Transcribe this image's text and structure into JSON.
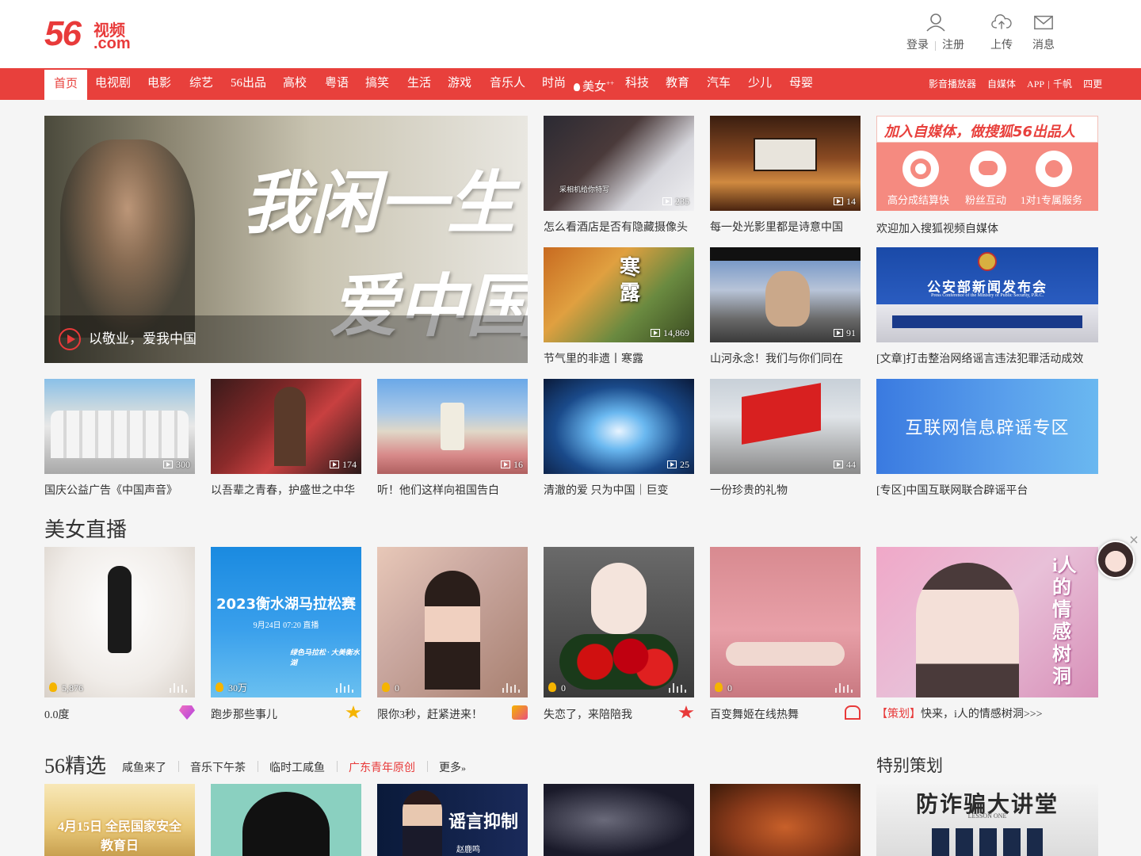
{
  "header": {
    "logo_num": "56",
    "logo_cn": "视频",
    "logo_com": ".com",
    "login": "登录",
    "register": "注册",
    "upload": "上传",
    "messages": "消息"
  },
  "nav": {
    "items": [
      "首页",
      "电视剧",
      "电影",
      "综艺",
      "56出品",
      "高校",
      "粤语",
      "搞笑",
      "生活",
      "游戏",
      "音乐人",
      "时尚",
      "美女",
      "科技",
      "教育",
      "汽车",
      "少儿",
      "母婴"
    ],
    "right": [
      "影音播放器",
      "自媒体",
      "APP",
      "千帆",
      "四更"
    ],
    "beauty_sup": "++"
  },
  "hero": {
    "title": "以敬业，爱我中国",
    "art_line1": "我闲一生",
    "art_line2": "爱中国"
  },
  "grid": [
    {
      "caption": "怎么看酒店是否有隐藏摄像头",
      "count": "235"
    },
    {
      "caption": "每一处光影里都是诗意中国",
      "count": "14"
    },
    {
      "caption": "节气里的非遗丨寒露",
      "count": "14,869"
    },
    {
      "caption": "山河永念！我们与你们同在",
      "count": "91"
    },
    {
      "caption": "国庆公益广告《中国声音》",
      "count": "300"
    },
    {
      "caption": "以吾辈之青春，护盛世之中华",
      "count": "174"
    },
    {
      "caption": "听！他们这样向祖国告白",
      "count": "16"
    },
    {
      "caption": "清澈的爱 只为中国｜巨变",
      "count": "25"
    },
    {
      "caption": "一份珍贵的礼物",
      "count": "44"
    }
  ],
  "thumb_text": {
    "hotel_sub": "采相机给你特写",
    "hanlu": "寒露"
  },
  "promo": {
    "headline": "加入自媒体，做搜狐56出品人",
    "f1": "高分成结算快",
    "f2": "粉丝互动",
    "f3": "1对1专属服务",
    "caption": "欢迎加入搜狐视频自媒体"
  },
  "police": {
    "banner": "公安部新闻发布会",
    "banner_en": "Press Conference of the Ministry of Public Security, P.R.C.",
    "caption": "[文章]打击整治网络谣言违法犯罪活动成效"
  },
  "rumor": {
    "banner": "互联网信息辟谣专区",
    "caption": "[专区]中国互联网联合辟谣平台"
  },
  "live": {
    "section_title": "美女直播",
    "items": [
      {
        "caption": "0.0度",
        "heat": "5,876"
      },
      {
        "caption": "跑步那些事儿",
        "heat": "30万"
      },
      {
        "caption": "限你3秒，赶紧进来！",
        "heat": "0"
      },
      {
        "caption": "失恋了，来陪陪我",
        "heat": "0"
      },
      {
        "caption": "百变舞姬在线热舞",
        "heat": "0"
      }
    ],
    "marathon_title": "2023衡水湖马拉松赛",
    "marathon_time": "9月24日 07:20 直播",
    "marathon_slogan": "绿色马拉松 · 大美衡水湖",
    "plan_tag": "【策划】",
    "plan_caption": "快来，i人的情感树洞>>>",
    "plan_art": "i人的情感树洞"
  },
  "picks": {
    "section_title": "56精选",
    "tabs": [
      "咸鱼来了",
      "音乐下午茶",
      "临时工咸鱼",
      "广东青年原创",
      "更多"
    ],
    "special_title": "特别策划",
    "t1": "4月15日 全民国家安全教育日",
    "t3": "谣言抑制",
    "t3_name": "赵鹿鸣",
    "special_banner": "防诈骗大讲堂",
    "special_sub": "LESSON ONE"
  },
  "colors": {
    "brand_red": "#e8403c",
    "promo_pink": "#f58a80",
    "rumor_blue": "#4a8fe0"
  }
}
